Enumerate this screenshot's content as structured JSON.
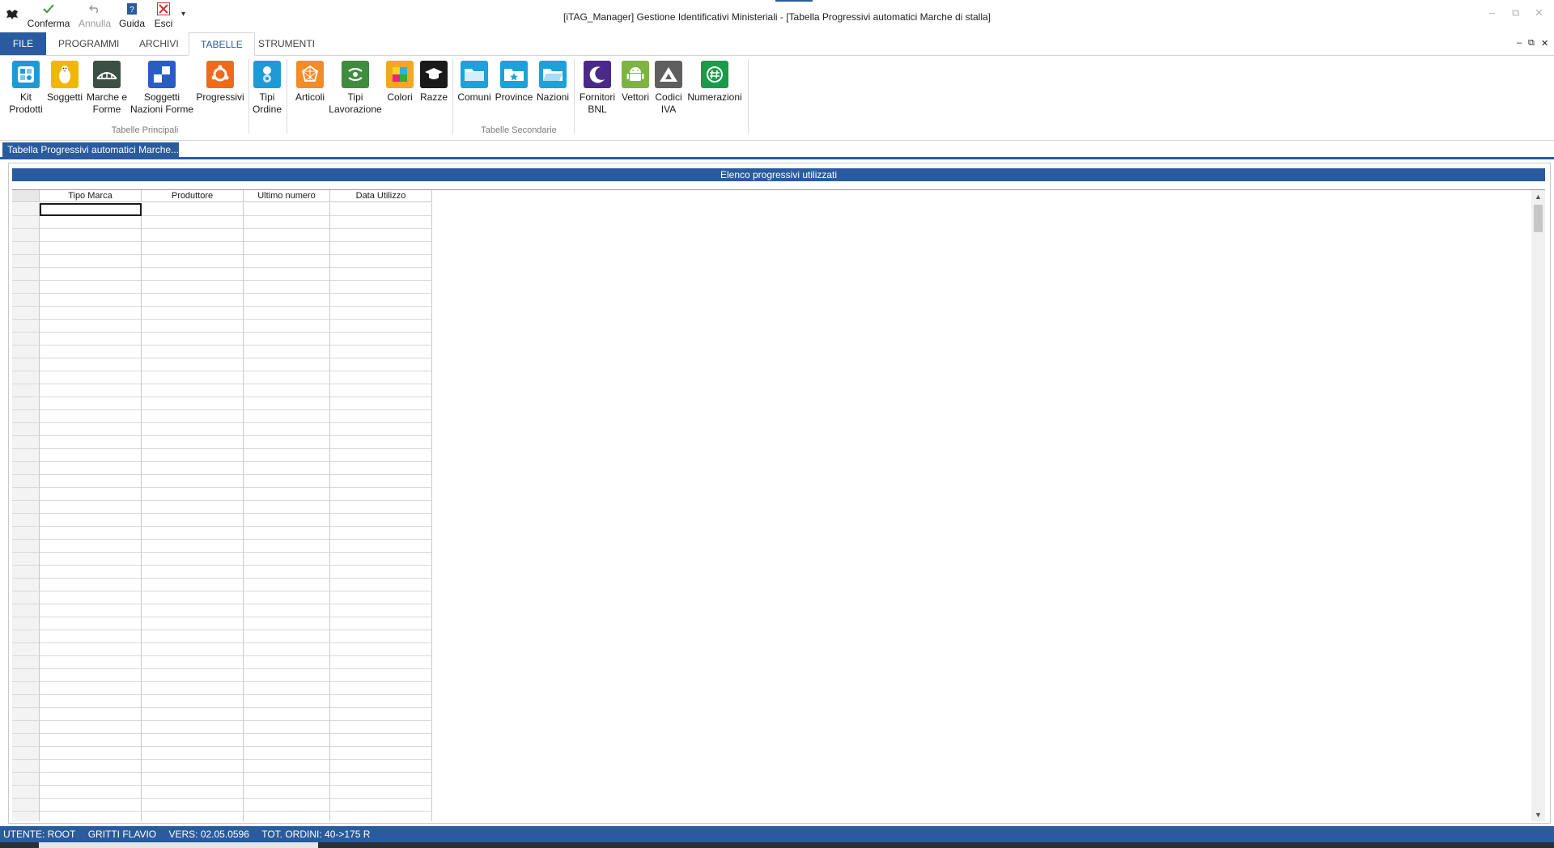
{
  "window": {
    "title": "[iTAG_Manager] Gestione Identificativi Ministeriali - [Tabella Progressivi automatici Marche di stalla]",
    "controls": {
      "minimize": "–",
      "restore": "⧉",
      "close": "✕"
    }
  },
  "qat": {
    "conferma": "Conferma",
    "annulla": "Annulla",
    "guida": "Guida",
    "esci": "Esci",
    "more": "▾"
  },
  "tabs": {
    "file": "FILE",
    "programmi": "PROGRAMMI",
    "archivi": "ARCHIVI",
    "tabelle": "TABELLE",
    "strumenti": "STRUMENTI"
  },
  "mdi": {
    "minimize": "–",
    "restore": "⧉",
    "close": "✕"
  },
  "ribbon": {
    "group_principali": "Tabelle Principali",
    "group_secondarie": "Tabelle Secondarie",
    "buttons": [
      {
        "line1": "Kit",
        "line2": "Prodotti"
      },
      {
        "line1": "Soggetti",
        "line2": ""
      },
      {
        "line1": "Marche e",
        "line2": "Forme"
      },
      {
        "line1": "Soggetti",
        "line2": "Nazioni Forme"
      },
      {
        "line1": "Progressivi",
        "line2": ""
      },
      {
        "line1": "Tipi",
        "line2": "Ordine"
      },
      {
        "line1": "Articoli",
        "line2": ""
      },
      {
        "line1": "Tipi",
        "line2": "Lavorazione"
      },
      {
        "line1": "Colori",
        "line2": ""
      },
      {
        "line1": "Razze",
        "line2": ""
      },
      {
        "line1": "Comuni",
        "line2": ""
      },
      {
        "line1": "Province",
        "line2": ""
      },
      {
        "line1": "Nazioni",
        "line2": ""
      },
      {
        "line1": "Fornitori",
        "line2": "BNL"
      },
      {
        "line1": "Vettori",
        "line2": ""
      },
      {
        "line1": "Codici",
        "line2": "IVA"
      },
      {
        "line1": "Numerazioni",
        "line2": ""
      }
    ]
  },
  "document_tab": {
    "label": "Tabella Progressivi automatici Marche..."
  },
  "panel": {
    "header": "Elenco progressivi utilizzati"
  },
  "grid": {
    "columns": [
      "Tipo Marca",
      "Produttore",
      "Ultimo numero",
      "Data Utilizzo"
    ]
  },
  "scrollbar": {
    "up": "▲",
    "down": "▼"
  },
  "status": {
    "utente": "UTENTE: ROOT",
    "nome": "GRITTI FLAVIO",
    "vers": "VERS: 02.05.0596",
    "ordini": "TOT. ORDINI: 40->175 R"
  },
  "colors": {
    "accent": "#2a5b9e",
    "kit": "#1e9bd7",
    "soggetti": "#f2b705",
    "marche": "#3c4f44",
    "nazioni_forme": "#2a5dc2",
    "progressivi": "#f06a1c",
    "tipi_ordine": "#1e9bd7",
    "articoli": "#f28c28",
    "lavorazione": "#3f8c3f",
    "razze": "#1a1a1a",
    "comuni": "#1ea0d8",
    "fornitori": "#4a2a88",
    "vettori": "#7cb342",
    "codici": "#5f5f5f",
    "numerazioni": "#1a9b4a"
  }
}
